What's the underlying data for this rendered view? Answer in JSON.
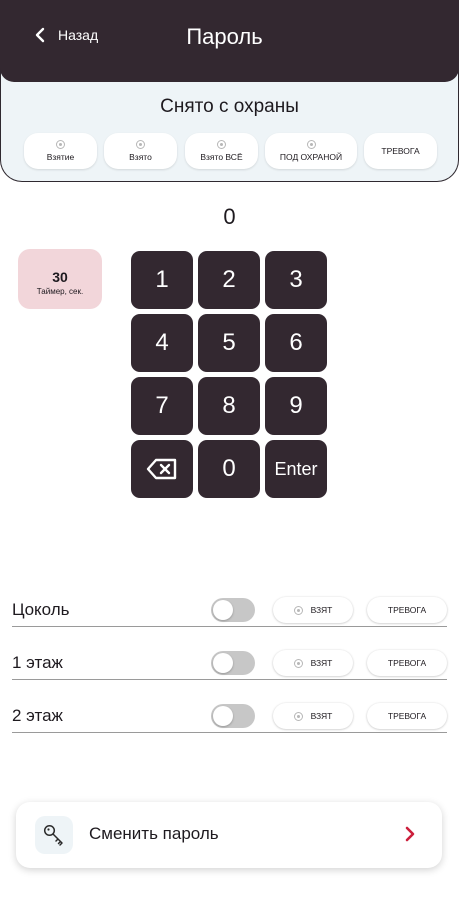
{
  "header": {
    "back_label": "Назад",
    "title": "Пароль"
  },
  "status": {
    "text": "Снято с охраны",
    "modes": [
      "Взятие",
      "Взято",
      "Взято ВСЁ",
      "ПОД ОХРАНОЙ",
      "ТРЕВОГА"
    ]
  },
  "display": {
    "value": "0"
  },
  "timer": {
    "value": "30",
    "label": "Таймер, сек."
  },
  "keypad": {
    "keys": [
      "1",
      "2",
      "3",
      "4",
      "5",
      "6",
      "7",
      "8",
      "9",
      "backspace",
      "0",
      "Enter"
    ]
  },
  "zones": [
    {
      "name": "Цоколь",
      "taken_label": "ВЗЯТ",
      "alarm_label": "ТРЕВОГА"
    },
    {
      "name": "1 этаж",
      "taken_label": "ВЗЯТ",
      "alarm_label": "ТРЕВОГА"
    },
    {
      "name": "2 этаж",
      "taken_label": "ВЗЯТ",
      "alarm_label": "ТРЕВОГА"
    }
  ],
  "change_password": {
    "label": "Сменить пароль",
    "icon": "key-icon"
  },
  "colors": {
    "primary_dark": "#332830",
    "accent_red": "#cc1f3c",
    "panel_bg": "#eef4f7",
    "timer_bg": "#f2d6da"
  }
}
